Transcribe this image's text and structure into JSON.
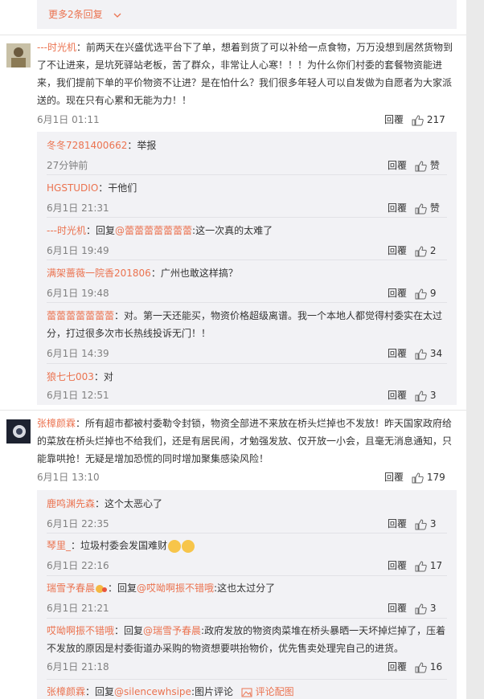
{
  "more_replies": "更多2条回复",
  "comments": [
    {
      "user": "---时光机",
      "text": "：前两天在兴盛优选平台下了单，想着到货了可以补给一点食物，万万没想到居然货物到了不让进来，是坑死驿站老板，苦了群众，非常让人心寒！！！为什么你们村委的套餐物资能进来，我们提前下单的平价物资不让进？是在怕什么？我们很多年轻人可以自发做为自愿者为大家派送的。现在只有心累和无能为力！！",
      "time": "6月1日 01:11",
      "reply": "回覆",
      "likes": "217"
    },
    {
      "user": "张樟颜霖",
      "text": "：所有超市都被村委勒令封锁，物资全部进不来放在桥头烂掉也不发放！昨天国家政府给的菜放在桥头烂掉也不给我们，还是有居民闹，才勉强发放、仅开放一小会，且毫无消息通知，只能靠哄抢！无疑是增加恐慌的同时增加聚集感染风险！",
      "time": "6月1日 13:10",
      "reply": "回覆",
      "likes": "179"
    }
  ],
  "replies_a": [
    {
      "user": "冬冬7281400662",
      "text": "：举报",
      "time": "27分钟前",
      "reply": "回覆",
      "likes": "赞"
    },
    {
      "user": "HGSTUDIO",
      "text": "：干他们",
      "time": "6月1日 21:31",
      "reply": "回覆",
      "likes": "赞"
    },
    {
      "user": "---时光机",
      "pre": "：回复",
      "mention": "@蕾蕾蕾蕾蕾蕾蕾",
      "text": ":这一次真的太难了",
      "time": "6月1日 19:49",
      "reply": "回覆",
      "likes": "2"
    },
    {
      "user": "满架蔷薇一院香201806",
      "text": "：广州也敢这样搞？",
      "time": "6月1日 19:48",
      "reply": "回覆",
      "likes": "9"
    },
    {
      "user": "蕾蕾蕾蕾蕾蕾蕾",
      "text": "：对。第一天还能买，物资价格超级离谱。我一个本地人都觉得村委实在太过分，打过很多次市长热线投诉无门！！",
      "time": "6月1日 14:39",
      "reply": "回覆",
      "likes": "34"
    },
    {
      "user": "狼七七003",
      "text": "：对",
      "time": "6月1日 12:51",
      "reply": "回覆",
      "likes": "3"
    }
  ],
  "replies_b": [
    {
      "user": "鹿鸣渊先森",
      "text": "：这个太恶心了",
      "time": "6月1日 22:35",
      "reply": "回覆",
      "likes": "3"
    },
    {
      "user": "琴里_",
      "text": "：垃圾村委会发国难财",
      "time": "6月1日 22:16",
      "reply": "回覆",
      "likes": "17"
    },
    {
      "user": "瑞雪予春晨",
      "pre": "：回复",
      "mention": "@哎呦啊振不错哦",
      "text": ":这也太过分了",
      "time": "6月1日 21:21",
      "reply": "回覆",
      "likes": "3"
    },
    {
      "user": "哎呦啊振不错哦",
      "pre": "：回复",
      "mention": "@瑞雪予春晨",
      "text": ":政府发放的物资肉菜堆在桥头暴晒一天坏掉烂掉了，压着不发放的原因是村委街道办采购的物资想要哄抬物价，优先售卖处理完自己的进货。",
      "time": "6月1日 21:18",
      "reply": "回覆",
      "likes": "16"
    },
    {
      "user": "张樟颜霖",
      "pre": "：回复",
      "mention": "@silencewhsipe",
      "text": ":图片评论",
      "extra": "评论配图"
    }
  ],
  "icons": {
    "thumb": "thumbs-up-icon",
    "chevron": "chevron-down-icon"
  },
  "colors": {
    "accent": "#eb7350",
    "panel": "#f2f2f5"
  }
}
